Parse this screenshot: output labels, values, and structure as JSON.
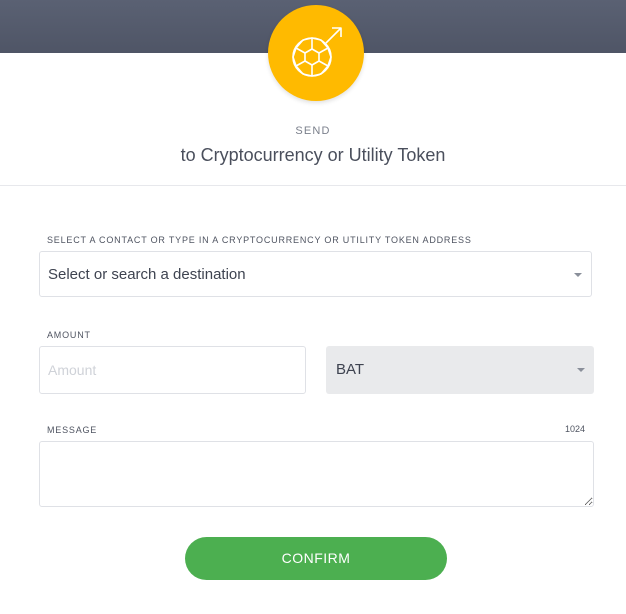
{
  "header": {
    "icon": "globe-send-icon",
    "badge_color": "#ffba00",
    "bar_color": "#545b6c",
    "send_label": "SEND",
    "title": "to Cryptocurrency or Utility Token"
  },
  "destination": {
    "label": "SELECT A CONTACT OR TYPE IN A CRYPTOCURRENCY OR UTILITY TOKEN ADDRESS",
    "value": "Select or search a destination"
  },
  "amount": {
    "label": "AMOUNT",
    "placeholder": "Amount",
    "value": "",
    "token": "BAT"
  },
  "message": {
    "label": "MESSAGE",
    "counter": "1024",
    "value": ""
  },
  "confirm": {
    "label": "CONFIRM",
    "color": "#4caf50"
  }
}
